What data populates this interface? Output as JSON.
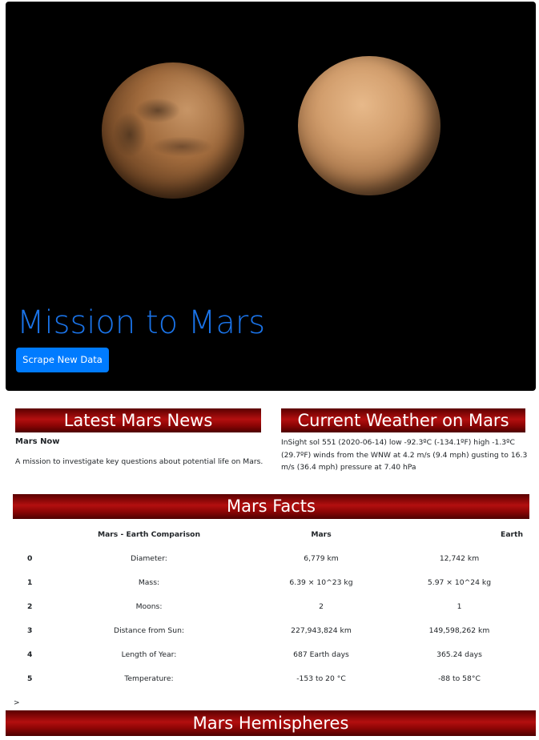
{
  "hero": {
    "title": "Mission to Mars",
    "scrape_button_label": "Scrape New Data"
  },
  "news": {
    "heading": "Latest Mars News",
    "title": "Mars Now",
    "paragraph": "A mission to investigate key questions about potential life on Mars."
  },
  "weather": {
    "heading": "Current Weather on Mars",
    "text": "InSight sol 551 (2020-06-14) low -92.3ºC (-134.1ºF) high -1.3ºC (29.7ºF) winds from the WNW at 4.2 m/s (9.4 mph) gusting to 16.3 m/s (36.4 mph) pressure at 7.40 hPa"
  },
  "facts": {
    "heading": "Mars Facts",
    "columns": [
      "",
      "Mars - Earth Comparison",
      "Mars",
      "Earth"
    ],
    "rows": [
      {
        "index": "0",
        "label": "Diameter:",
        "mars": "6,779 km",
        "earth": "12,742 km"
      },
      {
        "index": "1",
        "label": "Mass:",
        "mars": "6.39 × 10^23 kg",
        "earth": "5.97 × 10^24 kg"
      },
      {
        "index": "2",
        "label": "Moons:",
        "mars": "2",
        "earth": "1"
      },
      {
        "index": "3",
        "label": "Distance from Sun:",
        "mars": "227,943,824 km",
        "earth": "149,598,262 km"
      },
      {
        "index": "4",
        "label": "Length of Year:",
        "mars": "687 Earth days",
        "earth": "365.24 days"
      },
      {
        "index": "5",
        "label": "Temperature:",
        "mars": "-153 to 20 °C",
        "earth": "-88 to 58°C"
      }
    ],
    "stray_char": ">"
  },
  "hemispheres": {
    "heading": "Mars Hemispheres"
  },
  "colors": {
    "title_blue": "#1a73e8",
    "button_blue": "#007bff",
    "heading_red": "#b30f0f"
  }
}
